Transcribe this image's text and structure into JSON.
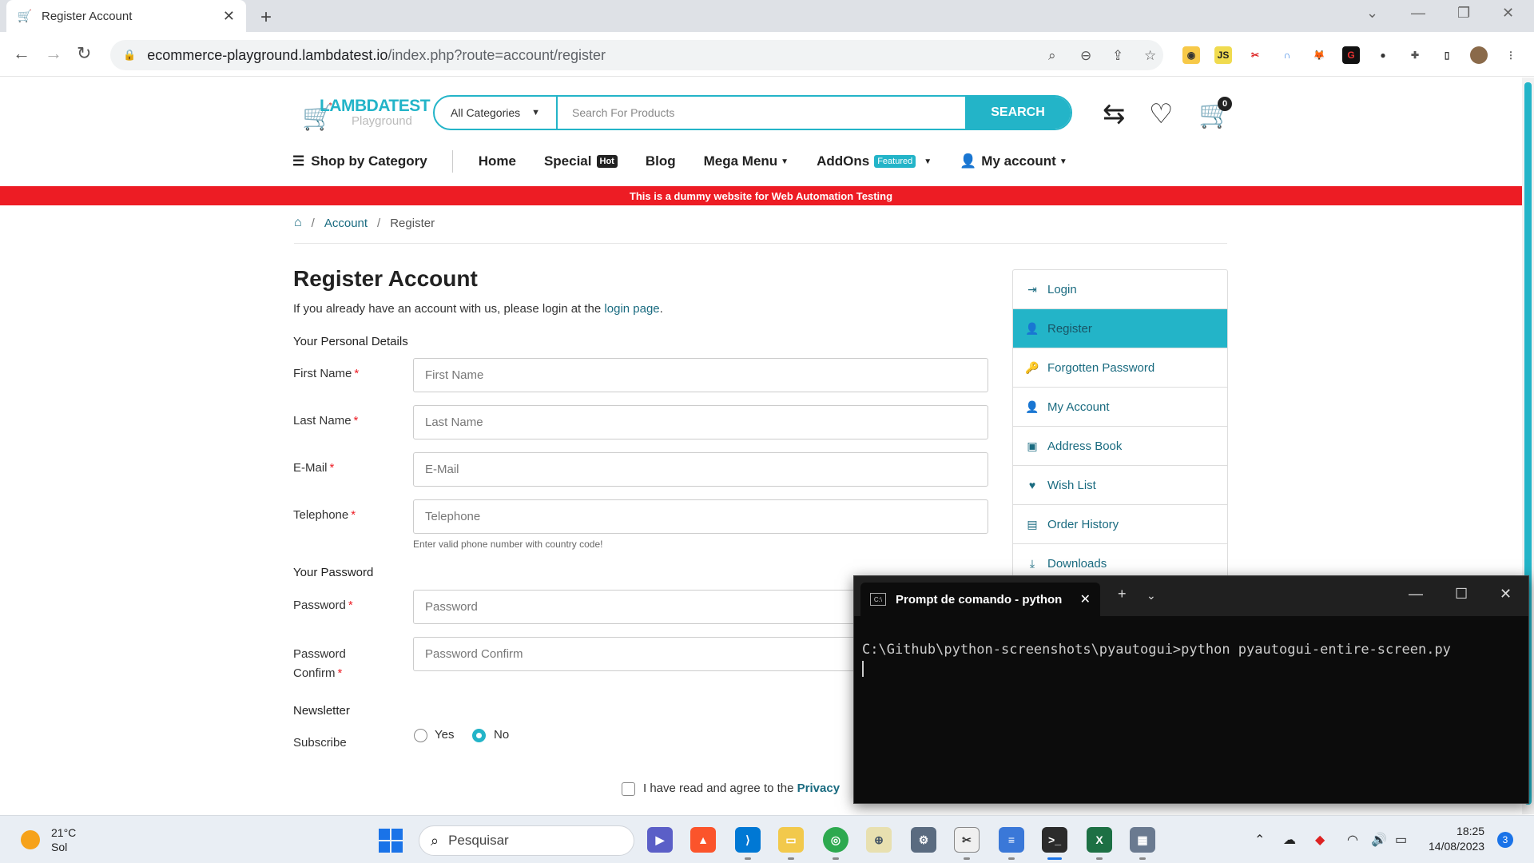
{
  "browser": {
    "tab_title": "Register Account",
    "url_host": "ecommerce-playground.lambdatest.io",
    "url_path": "/index.php?route=account/register"
  },
  "header": {
    "logo_main": "LAMBDATEST",
    "logo_sub": "Playground",
    "category_select": "All Categories",
    "search_placeholder": "Search For Products",
    "search_button": "SEARCH",
    "cart_count": "0"
  },
  "menu": {
    "shop_by_category": "Shop by Category",
    "home": "Home",
    "special": "Special",
    "hot_badge": "Hot",
    "blog": "Blog",
    "mega_menu": "Mega Menu",
    "addons": "AddOns",
    "featured_badge": "Featured",
    "my_account": "My account"
  },
  "banner": "This is a dummy website for Web Automation Testing",
  "breadcrumb": {
    "account": "Account",
    "register": "Register"
  },
  "form": {
    "title": "Register Account",
    "intro_prefix": "If you already have an account with us, please login at the",
    "intro_link": "login page",
    "intro_suffix": ".",
    "personal_details": "Your Personal Details",
    "first_name_label": "First Name",
    "first_name_placeholder": "First Name",
    "last_name_label": "Last Name",
    "last_name_placeholder": "Last Name",
    "email_label": "E-Mail",
    "email_placeholder": "E-Mail",
    "telephone_label": "Telephone",
    "telephone_placeholder": "Telephone",
    "telephone_hint": "Enter valid phone number with country code!",
    "password_section": "Your Password",
    "password_label": "Password",
    "password_placeholder": "Password",
    "password_confirm_label_1": "Password",
    "password_confirm_label_2": "Confirm",
    "password_confirm_placeholder": "Password Confirm",
    "newsletter_section": "Newsletter",
    "subscribe_label": "Subscribe",
    "yes": "Yes",
    "no": "No",
    "subscribe_selected": "No",
    "agree_text": "I have read and agree to the",
    "agree_link": "Privacy",
    "required_mark": "*"
  },
  "sidebar": [
    {
      "label": "Login",
      "icon": "sign-in-icon",
      "glyph": "⇥",
      "active": false
    },
    {
      "label": "Register",
      "icon": "user-plus-icon",
      "glyph": "👤",
      "active": true
    },
    {
      "label": "Forgotten Password",
      "icon": "key-icon",
      "glyph": "🔑",
      "active": false
    },
    {
      "label": "My Account",
      "icon": "user-icon",
      "glyph": "👤",
      "active": false
    },
    {
      "label": "Address Book",
      "icon": "address-book-icon",
      "glyph": "▣",
      "active": false
    },
    {
      "label": "Wish List",
      "icon": "heart-icon",
      "glyph": "♥",
      "active": false
    },
    {
      "label": "Order History",
      "icon": "order-history-icon",
      "glyph": "▤",
      "active": false
    },
    {
      "label": "Downloads",
      "icon": "download-icon",
      "glyph": "⤓",
      "active": false
    }
  ],
  "terminal": {
    "title": "Prompt de comando - python",
    "command_line": "C:\\Github\\python-screenshots\\pyautogui>python pyautogui-entire-screen.py"
  },
  "taskbar": {
    "temperature": "21°C",
    "weather": "Sol",
    "search_placeholder": "Pesquisar",
    "time": "18:25",
    "date": "14/08/2023",
    "notifications": "3"
  },
  "colors": {
    "accent": "#23b4c8",
    "link": "#1a6b80",
    "banner": "#ed1c24",
    "required": "#ed1c24"
  }
}
